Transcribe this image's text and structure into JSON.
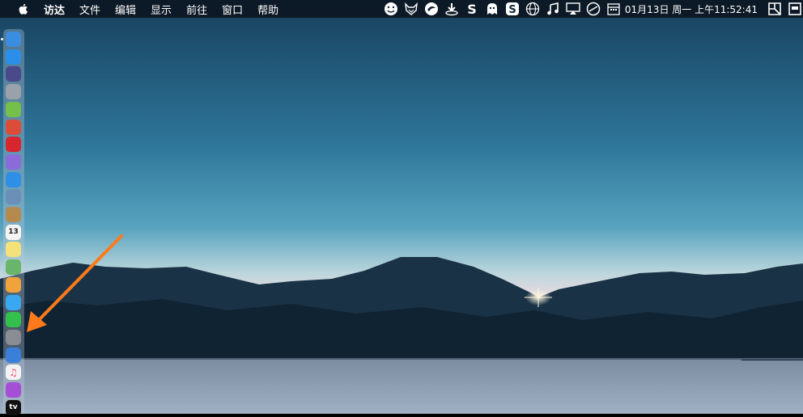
{
  "menubar": {
    "app_name": "访达",
    "items": [
      "文件",
      "编辑",
      "显示",
      "前往",
      "窗口",
      "帮助"
    ],
    "clock_date": "01月13日 周一",
    "clock_time": "上午11:52:41",
    "status_icons": [
      "face-icon",
      "fox-icon",
      "circle-icon",
      "download-icon",
      "s-icon",
      "ghost-icon",
      "sogou-icon",
      "globe-icon",
      "music-note-icon",
      "airplay-icon",
      "sync-icon",
      "calendar-icon",
      "grid-icon",
      "window-icon"
    ]
  },
  "dock": {
    "apps": [
      {
        "name": "finder",
        "color": "#3b8de0"
      },
      {
        "name": "app-store",
        "color": "#2b8fea"
      },
      {
        "name": "siri",
        "color": "#4a4a8a"
      },
      {
        "name": "launchpad",
        "color": "#9aa1ab"
      },
      {
        "name": "android-file-transfer",
        "color": "#74c04a"
      },
      {
        "name": "chrome",
        "color": "#dd4b39"
      },
      {
        "name": "red-app",
        "color": "#d8262e"
      },
      {
        "name": "purple-app",
        "color": "#8b6bd8"
      },
      {
        "name": "safari",
        "color": "#2f8fe6"
      },
      {
        "name": "preview",
        "color": "#6a8fb8"
      },
      {
        "name": "notes-brown",
        "color": "#b48a4e"
      },
      {
        "name": "calendar",
        "color": "#f5f5f5",
        "label": "13"
      },
      {
        "name": "notes",
        "color": "#f3e27a"
      },
      {
        "name": "maps",
        "color": "#6ab56c"
      },
      {
        "name": "photos",
        "color": "#f0a23c"
      },
      {
        "name": "messages",
        "color": "#39a8f0"
      },
      {
        "name": "facetime",
        "color": "#34c04c"
      },
      {
        "name": "system-preferences",
        "color": "#8a8d93"
      },
      {
        "name": "keynote",
        "color": "#3a7fd9"
      },
      {
        "name": "music",
        "color": "#f3f3f3"
      },
      {
        "name": "podcasts",
        "color": "#a44fd6"
      },
      {
        "name": "apple-tv",
        "color": "#111111",
        "label": "tv"
      }
    ]
  },
  "colors": {
    "sky_top": "#1c5072",
    "sky_mid": "#3b88a8",
    "horizon": "#e9d8dc",
    "mountain": "#13283a",
    "lake": "#8697ab",
    "arrow": "#ff7a1a"
  }
}
